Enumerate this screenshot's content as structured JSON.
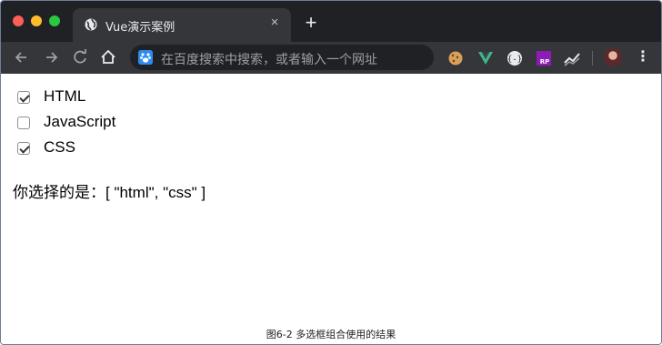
{
  "browser": {
    "tab_title": "Vue演示案例",
    "tab_close": "×",
    "new_tab": "+",
    "omnibox_placeholder": "在百度搜索中搜索，或者输入一个网址",
    "accent_colors": {
      "close": "#fe5f57",
      "minimize": "#febc2e",
      "maximize": "#28c840"
    },
    "extensions": [
      "cookie-icon",
      "vue-devtools-icon",
      "json-viewer-icon",
      "rp-icon",
      "chart-icon",
      "profile-avatar",
      "menu-icon"
    ]
  },
  "options": [
    {
      "label": "HTML",
      "checked": true
    },
    {
      "label": "JavaScript",
      "checked": false
    },
    {
      "label": "CSS",
      "checked": true
    }
  ],
  "result": {
    "label": "你选择的是：",
    "value": "[ \"html\", \"css\" ]"
  },
  "caption": "图6-2  多选框组合使用的结果"
}
